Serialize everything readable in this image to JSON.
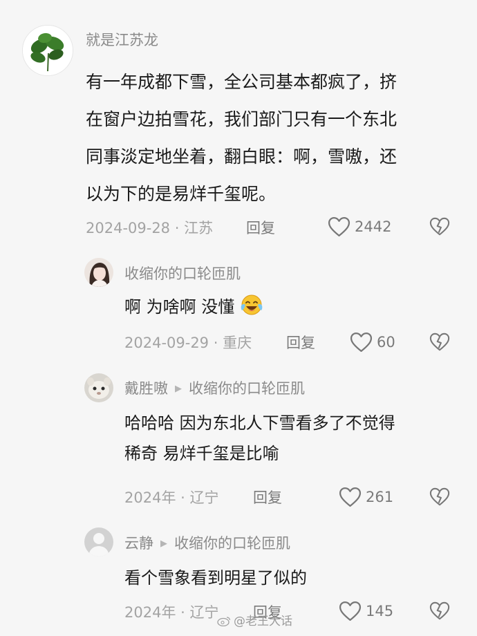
{
  "comments": [
    {
      "author": "就是江苏龙",
      "lines": [
        "有一年成都下雪，全公司基本都疯了，挤",
        "在窗户边拍雪花，我们部门只有一个东北",
        "同事淡定地坐着，翻白眼：啊，雪嗷，还",
        "以为下的是易烊千玺呢。"
      ],
      "date": "2024-09-28",
      "location": "江苏",
      "reply_label": "回复",
      "likes": "2442",
      "avatar_icon": "plant-avatar-icon"
    },
    {
      "author": "收缩你的口轮匝肌",
      "lines": [
        "啊 为啥啊 没懂"
      ],
      "emoji_icon": "laughing-crying-emoji-icon",
      "date": "2024-09-29",
      "location": "重庆",
      "reply_label": "回复",
      "likes": "60",
      "avatar_icon": "girl-avatar-icon"
    },
    {
      "author": "戴胜嗷",
      "reply_to": "收缩你的口轮匝肌",
      "lines": [
        "哈哈哈 因为东北人下雪看多了不觉得",
        "稀奇 易烊千玺是比喻"
      ],
      "date": "2024年",
      "location": "辽宁",
      "reply_label": "回复",
      "likes": "261",
      "avatar_icon": "animal-avatar-icon"
    },
    {
      "author": "云静",
      "reply_to": "收缩你的口轮匝肌",
      "lines": [
        "看个雪象看到明星了似的"
      ],
      "date": "2024年",
      "location": "辽宁",
      "reply_label": "回复",
      "likes": "145",
      "avatar_icon": "default-user-avatar-icon"
    }
  ],
  "separator": "·",
  "watermark": "@老王大话"
}
